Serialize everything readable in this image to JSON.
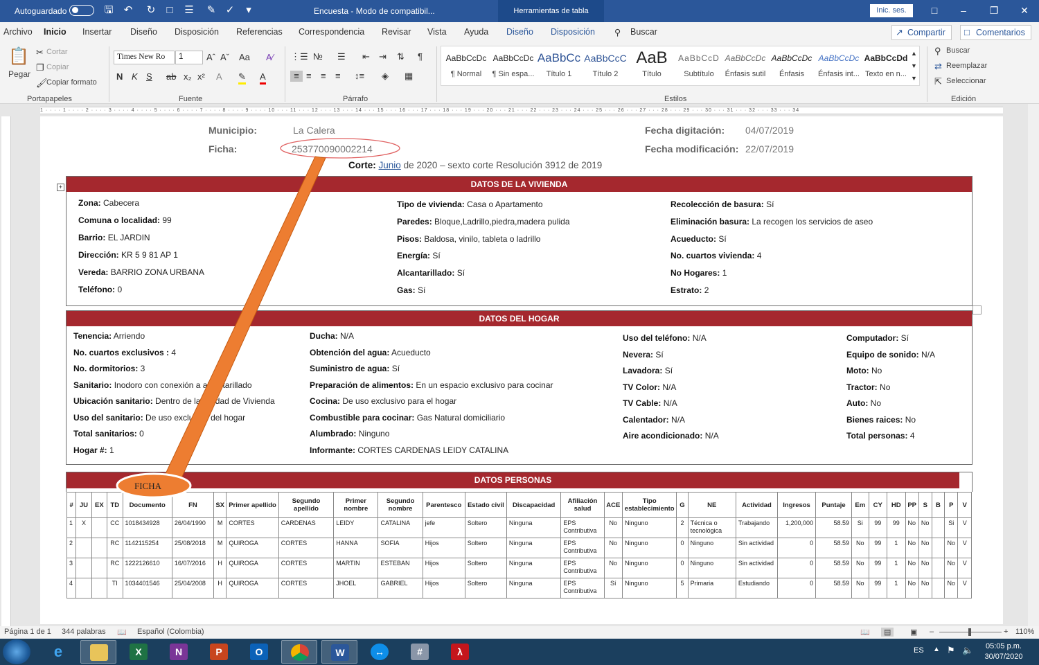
{
  "window": {
    "autosave": "Autoguardado",
    "title": "Encuesta  -  Modo de compatibil...",
    "tools_tab": "Herramientas de tabla",
    "signin": "Inic. ses."
  },
  "menu": {
    "items": [
      "Archivo",
      "Inicio",
      "Insertar",
      "Diseño",
      "Disposición",
      "Referencias",
      "Correspondencia",
      "Revisar",
      "Vista",
      "Ayuda",
      "Diseño",
      "Disposición"
    ],
    "search": "Buscar",
    "share": "Compartir",
    "comments": "Comentarios"
  },
  "ribbon": {
    "clipboard": {
      "paste": "Pegar",
      "cut": "Cortar",
      "copy": "Copiar",
      "format_painter": "Copiar formato",
      "group": "Portapapeles"
    },
    "font": {
      "name": "Times New Ro",
      "size": "1",
      "group": "Fuente"
    },
    "paragraph": {
      "group": "Párrafo"
    },
    "styles": {
      "group": "Estilos",
      "items": [
        {
          "preview": "AaBbCcDc",
          "name": "¶ Normal"
        },
        {
          "preview": "AaBbCcDc",
          "name": "¶ Sin espa..."
        },
        {
          "preview": "AaBbCc",
          "name": "Título 1"
        },
        {
          "preview": "AaBbCcC",
          "name": "Título 2"
        },
        {
          "preview": "AaB",
          "name": "Título"
        },
        {
          "preview": "AaBbCcD",
          "name": "Subtítulo"
        },
        {
          "preview": "AaBbCcDc",
          "name": "Énfasis sutil"
        },
        {
          "preview": "AaBbCcDc",
          "name": "Énfasis"
        },
        {
          "preview": "AaBbCcDc",
          "name": "Énfasis int..."
        },
        {
          "preview": "AaBbCcDd",
          "name": "Texto en n..."
        }
      ]
    },
    "editing": {
      "find": "Buscar",
      "replace": "Reemplazar",
      "select": "Seleccionar",
      "group": "Edición"
    }
  },
  "ruler": {
    "marks": "1 · · · · 1 · · · · 2 · · · · 3 · · · · 4 · · · · 5 · · · · 6 · · · · 7 · · · · 8 · · · · 9 · · · · 10 · · · 11 · · · 12 · · · 13 · · · 14 · · · 15 · · · 16 · · · 17 · · · 18 · · · 19 · · · 20 · · · 21 · · · 22 · · · 23 · · · 24 · · · 25 · · · 26 · · · 27 · · · 28 · · · 29 · · · 30 · · · 31 · · · 32 · · · 33 · · · 34"
  },
  "header": {
    "municipio_label": "Municipio:",
    "municipio": "La Calera",
    "ficha_label": "Ficha:",
    "ficha": "253770090002214",
    "fecha_dig_label": "Fecha digitación:",
    "fecha_dig": "04/07/2019",
    "fecha_mod_label": "Fecha modificación:",
    "fecha_mod": "22/07/2019",
    "corte_label": "Corte:",
    "corte_month": "Junio",
    "corte_rest": "de 2020 – sexto corte Resolución 3912 de 2019"
  },
  "vivienda": {
    "title": "DATOS DE LA VIVIENDA",
    "col1": [
      {
        "k": "Zona:",
        "v": "Cabecera"
      },
      {
        "k": "Comuna o localidad:",
        "v": "99"
      },
      {
        "k": "Barrio:",
        "v": "EL JARDIN"
      },
      {
        "k": "Dirección:",
        "v": "KR 5 9 81 AP 1"
      },
      {
        "k": "Vereda:",
        "v": "BARRIO ZONA URBANA"
      },
      {
        "k": "Teléfono:",
        "v": "0"
      }
    ],
    "col2": [
      {
        "k": "Tipo de vivienda:",
        "v": "Casa o Apartamento"
      },
      {
        "k": "Paredes:",
        "v": "Bloque,Ladrillo,piedra,madera pulida"
      },
      {
        "k": "Pisos:",
        "v": "Baldosa, vinilo, tableta o ladrillo"
      },
      {
        "k": "Energía:",
        "v": "Sí"
      },
      {
        "k": "Alcantarillado:",
        "v": "Sí"
      },
      {
        "k": "Gas:",
        "v": "Sí"
      }
    ],
    "col3": [
      {
        "k": "Recolección de basura:",
        "v": "Sí"
      },
      {
        "k": "Eliminación basura:",
        "v": "La recogen los servicios de aseo"
      },
      {
        "k": "Acueducto:",
        "v": "Sí"
      },
      {
        "k": "No. cuartos vivienda:",
        "v": "4"
      },
      {
        "k": "No Hogares:",
        "v": "1"
      },
      {
        "k": "Estrato:",
        "v": "2"
      }
    ]
  },
  "hogar": {
    "title": "DATOS DEL HOGAR",
    "col1": [
      {
        "k": "Tenencia:",
        "v": "Arriendo"
      },
      {
        "k": "No. cuartos exclusivos :",
        "v": "4"
      },
      {
        "k": "No. dormitorios:",
        "v": "3"
      },
      {
        "k": "Sanitario:",
        "v": "Inodoro con conexión a alcantarillado"
      },
      {
        "k": "Ubicación sanitario:",
        "v": "Dentro de la Unidad de Vivienda"
      },
      {
        "k": "Uso del sanitario:",
        "v": "De uso exclusivo del hogar"
      },
      {
        "k": "Total sanitarios:",
        "v": "0"
      },
      {
        "k": "Hogar #:",
        "v": "1"
      }
    ],
    "col2": [
      {
        "k": "Ducha:",
        "v": "N/A"
      },
      {
        "k": "Obtención del agua:",
        "v": "Acueducto"
      },
      {
        "k": "Suministro de agua:",
        "v": "Sí"
      },
      {
        "k": "Preparación de alimentos:",
        "v": "En un espacio exclusivo para cocinar"
      },
      {
        "k": "Cocina:",
        "v": "De uso exclusivo para el hogar"
      },
      {
        "k": "Combustible para cocinar:",
        "v": "Gas Natural domiciliario"
      },
      {
        "k": "Alumbrado:",
        "v": "Ninguno"
      },
      {
        "k": "Informante:",
        "v": "CORTES CARDENAS LEIDY CATALINA"
      }
    ],
    "col3": [
      {
        "k": "Uso del teléfono:",
        "v": "N/A"
      },
      {
        "k": "Nevera:",
        "v": "Sí"
      },
      {
        "k": "Lavadora:",
        "v": "Sí"
      },
      {
        "k": "TV Color:",
        "v": "N/A"
      },
      {
        "k": "TV Cable:",
        "v": "N/A"
      },
      {
        "k": "Calentador:",
        "v": "N/A"
      },
      {
        "k": "Aire acondicionado:",
        "v": "N/A"
      }
    ],
    "col4": [
      {
        "k": "Computador:",
        "v": "Sí"
      },
      {
        "k": "Equipo de sonido:",
        "v": "N/A"
      },
      {
        "k": "Moto:",
        "v": "No"
      },
      {
        "k": "Tractor:",
        "v": "No"
      },
      {
        "k": "Auto:",
        "v": "No"
      },
      {
        "k": "Bienes raices:",
        "v": "No"
      },
      {
        "k": "Total personas:",
        "v": "4"
      }
    ]
  },
  "personas": {
    "title": "DATOS PERSONAS",
    "columns": [
      "#",
      "JU",
      "EX",
      "TD",
      "Documento",
      "FN",
      "SX",
      "Primer apellido",
      "Segundo apellido",
      "Primer nombre",
      "Segundo nombre",
      "Parentesco",
      "Estado civil",
      "Discapacidad",
      "Afiliación salud",
      "ACE",
      "Tipo establecimiento",
      "G",
      "NE",
      "Actividad",
      "Ingresos",
      "Puntaje",
      "Em",
      "CY",
      "HD",
      "PP",
      "S",
      "B",
      "P",
      "V"
    ],
    "rows": [
      [
        "1",
        "X",
        "",
        "CC",
        "1018434928",
        "26/04/1990",
        "M",
        "CORTES",
        "CARDENAS",
        "LEIDY",
        "CATALINA",
        "jefe",
        "Soltero",
        "Ninguna",
        "EPS Contributiva",
        "No",
        "Ninguno",
        "2",
        "Técnica o tecnológica",
        "Trabajando",
        "1,200,000",
        "58.59",
        "Si",
        "99",
        "99",
        "No",
        "No",
        "",
        "Si",
        "V"
      ],
      [
        "2",
        "",
        "",
        "RC",
        "1142115254",
        "25/08/2018",
        "M",
        "QUIROGA",
        "CORTES",
        "HANNA",
        "SOFIA",
        "Hijos",
        "Soltero",
        "Ninguna",
        "EPS Contributiva",
        "No",
        "Ninguno",
        "0",
        "Ninguno",
        "Sin actividad",
        "0",
        "58.59",
        "No",
        "99",
        "1",
        "No",
        "No",
        "",
        "No",
        "V"
      ],
      [
        "3",
        "",
        "",
        "RC",
        "1222126610",
        "16/07/2016",
        "H",
        "QUIROGA",
        "CORTES",
        "MARTIN",
        "ESTEBAN",
        "Hijos",
        "Soltero",
        "Ninguna",
        "EPS Contributiva",
        "No",
        "Ninguno",
        "0",
        "Ninguno",
        "Sin actividad",
        "0",
        "58.59",
        "No",
        "99",
        "1",
        "No",
        "No",
        "",
        "No",
        "V"
      ],
      [
        "4",
        "",
        "",
        "TI",
        "1034401546",
        "25/04/2008",
        "H",
        "QUIROGA",
        "CORTES",
        "JHOEL",
        "GABRIEL",
        "Hijos",
        "Soltero",
        "Ninguna",
        "EPS Contributiva",
        "Sí",
        "Ninguno",
        "5",
        "Primaria",
        "Estudiando",
        "0",
        "58.59",
        "No",
        "99",
        "1",
        "No",
        "No",
        "",
        "No",
        "V"
      ]
    ]
  },
  "annotation": {
    "label": "FICHA",
    "color": "#ed7d31"
  },
  "status": {
    "page": "Página 1 de 1",
    "words": "344 palabras",
    "language": "Español (Colombia)",
    "zoom": "110%"
  },
  "taskbar": {
    "lang": "ES",
    "time": "05:05 p.m.",
    "date": "30/07/2020"
  },
  "colors": {
    "accent": "#2b579a",
    "band": "#a5282e"
  }
}
